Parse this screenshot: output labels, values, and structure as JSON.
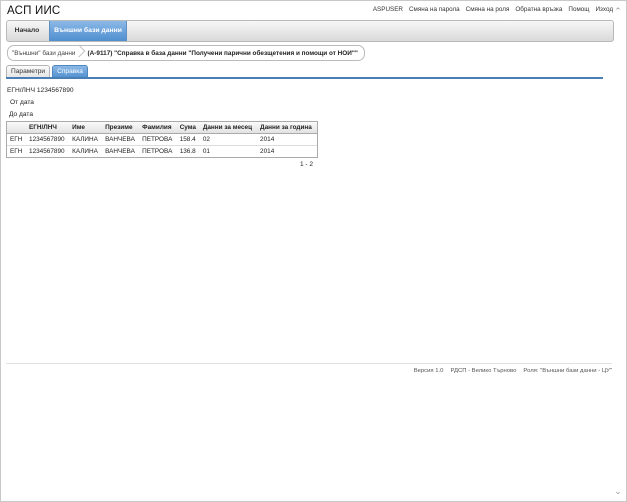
{
  "app": {
    "title": "АСП ИИС"
  },
  "toplinks": [
    "ASPUSER",
    "Смяна на парола",
    "Смяна на роля",
    "Обратна връзка",
    "Помощ",
    "Изход"
  ],
  "nav": {
    "home": "Начало",
    "external": "Външни бази данни"
  },
  "breadcrumb": {
    "first": "\"Външни\" бази данни",
    "current": "(А-9117) \"Справка в база данни \"Получени парични обезщетения и помощи от НОИ\"\""
  },
  "tabs": {
    "params": "Параметри",
    "report": "Справка"
  },
  "fields": {
    "egn": "ЕГН/ЛНЧ 1234567890",
    "from": "От дата",
    "to": "До дата"
  },
  "grid": {
    "headers": [
      "",
      "ЕГН/ЛНЧ",
      "Име",
      "Презиме",
      "Фамилия",
      "Сума",
      "Данни за месец",
      "Данни за година"
    ],
    "rows": [
      [
        "ЕГН",
        "1234567890",
        "КАЛИНА",
        "ВАНЧЕВА",
        "ПЕТРОВА",
        "158.4",
        "02",
        "2014"
      ],
      [
        "ЕГН",
        "1234567890",
        "КАЛИНА",
        "ВАНЧЕВА",
        "ПЕТРОВА",
        "136.8",
        "01",
        "2014"
      ]
    ]
  },
  "pager": "1 - 2",
  "footer": {
    "version": "Версия 1.0",
    "office": "РДСП - Велико Търново",
    "role": "Роля: \"Външни бази данни - ЦУ\""
  }
}
